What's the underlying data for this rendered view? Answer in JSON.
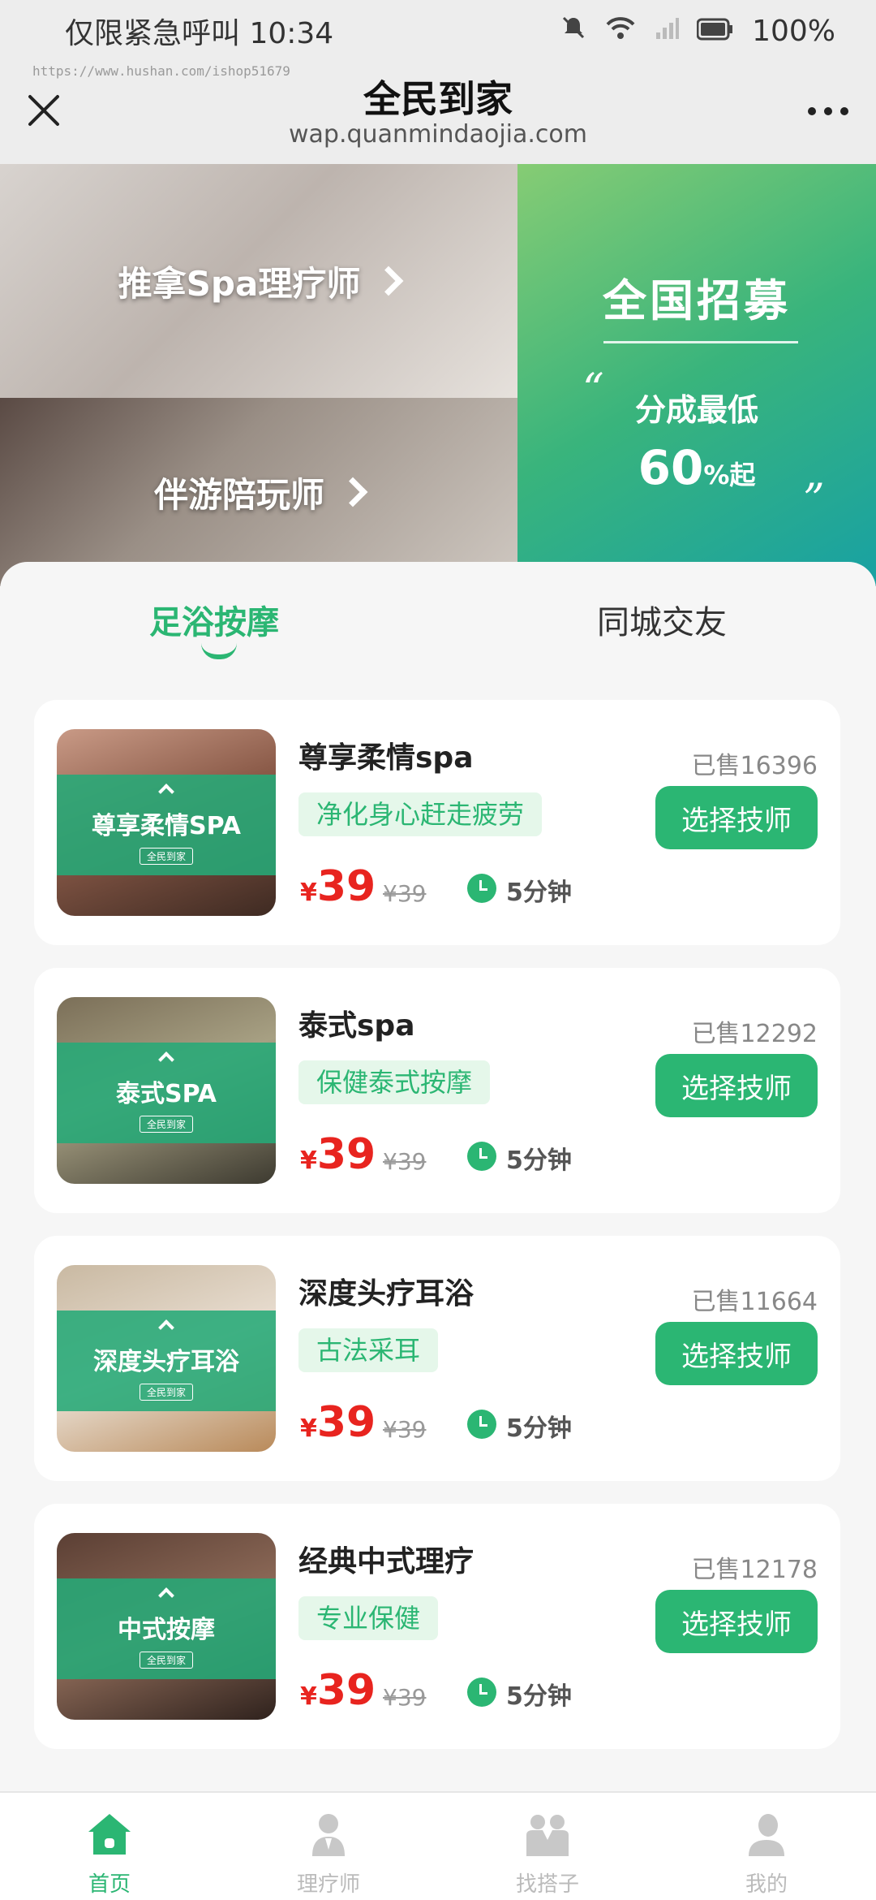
{
  "status": {
    "left_text": "仅限紧急呼叫 10:34",
    "battery": "100%"
  },
  "titlebar": {
    "title": "全民到家",
    "url": "wap.quanmindaojia.com",
    "watermark": "https://www.hushan.com/ishop51679"
  },
  "banner": {
    "spa_label": "推拿Spa理疗师",
    "companion_label": "伴游陪玩师",
    "recruit_title": "全国招募",
    "recruit_line1": "分成最低",
    "recruit_percent": "60",
    "recruit_suffix": "%起",
    "quote_open": "“",
    "quote_close": "”"
  },
  "tabs": [
    {
      "label": "足浴按摩",
      "active": true
    },
    {
      "label": "同城交友",
      "active": false
    }
  ],
  "services": [
    {
      "name": "尊享柔情spa",
      "thumb_title": "尊享柔情SPA",
      "thumb_tag": "全民到家",
      "sold": "已售16396",
      "tag": "净化身心赶走疲劳",
      "currency": "¥",
      "price": "39",
      "original_price": "¥39",
      "duration": "5分钟",
      "button": "选择技师"
    },
    {
      "name": "泰式spa",
      "thumb_title": "泰式SPA",
      "thumb_tag": "全民到家",
      "sold": "已售12292",
      "tag": "保健泰式按摩",
      "currency": "¥",
      "price": "39",
      "original_price": "¥39",
      "duration": "5分钟",
      "button": "选择技师"
    },
    {
      "name": "深度头疗耳浴",
      "thumb_title": "深度头疗耳浴",
      "thumb_tag": "全民到家",
      "sold": "已售11664",
      "tag": "古法采耳",
      "currency": "¥",
      "price": "39",
      "original_price": "¥39",
      "duration": "5分钟",
      "button": "选择技师"
    },
    {
      "name": "经典中式理疗",
      "thumb_title": "中式按摩",
      "thumb_tag": "全民到家",
      "sold": "已售12178",
      "tag": "专业保健",
      "currency": "¥",
      "price": "39",
      "original_price": "¥39",
      "duration": "5分钟",
      "button": "选择技师"
    }
  ],
  "tabbar": [
    {
      "label": "首页",
      "icon": "home-icon",
      "active": true
    },
    {
      "label": "理疗师",
      "icon": "therapist-icon",
      "active": false
    },
    {
      "label": "找搭子",
      "icon": "partner-icon",
      "active": false
    },
    {
      "label": "我的",
      "icon": "profile-icon",
      "active": false
    }
  ],
  "colors": {
    "accent": "#2bb673",
    "price": "#e8241f",
    "tag_bg": "#e5f7ea"
  }
}
